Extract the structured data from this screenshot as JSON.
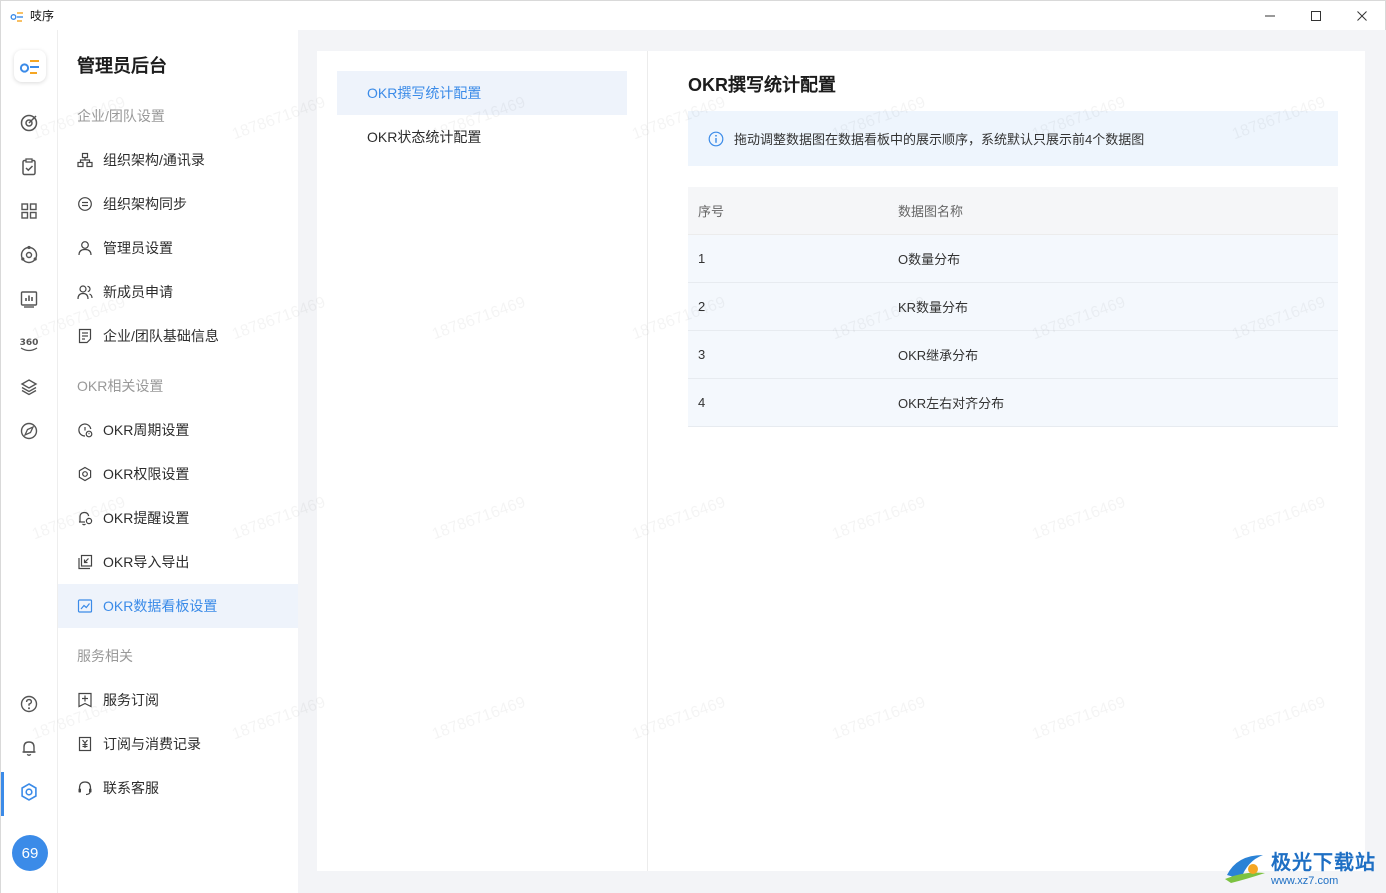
{
  "window": {
    "title": "吱序",
    "minimize": "—",
    "maximize": "☐",
    "close": "✕"
  },
  "rail": {
    "logo_icon": "app-logo-icon",
    "icons": [
      "target-icon",
      "clipboard-check-icon",
      "apps-grid-icon",
      "orbit-icon",
      "chart-board-icon",
      "360-icon",
      "layers-icon",
      "compass-icon",
      "help-icon",
      "bell-icon",
      "settings-icon"
    ],
    "avatar_text": "69"
  },
  "nav": {
    "title": "管理员后台",
    "sections": [
      {
        "label": "企业/团队设置"
      },
      {
        "label": "OKR相关设置"
      },
      {
        "label": "服务相关"
      }
    ],
    "items": [
      {
        "label": "组织架构/通讯录",
        "icon": "org-chart-icon"
      },
      {
        "label": "组织架构同步",
        "icon": "sync-icon"
      },
      {
        "label": "管理员设置",
        "icon": "user-icon"
      },
      {
        "label": "新成员申请",
        "icon": "users-icon"
      },
      {
        "label": "企业/团队基础信息",
        "icon": "document-icon"
      },
      {
        "label": "OKR周期设置",
        "icon": "cycle-icon"
      },
      {
        "label": "OKR权限设置",
        "icon": "gear-icon"
      },
      {
        "label": "OKR提醒设置",
        "icon": "bell-settings-icon"
      },
      {
        "label": "OKR导入导出",
        "icon": "import-export-icon"
      },
      {
        "label": "OKR数据看板设置",
        "icon": "dashboard-icon",
        "active": true
      },
      {
        "label": "服务订阅",
        "icon": "subscribe-icon"
      },
      {
        "label": "订阅与消费记录",
        "icon": "yen-record-icon"
      },
      {
        "label": "联系客服",
        "icon": "headset-icon"
      }
    ]
  },
  "sub_menu": {
    "items": [
      {
        "label": "OKR撰写统计配置",
        "active": true
      },
      {
        "label": "OKR状态统计配置"
      }
    ]
  },
  "main": {
    "title": "OKR撰写统计配置",
    "notice": "拖动调整数据图在数据看板中的展示顺序，系统默认只展示前4个数据图",
    "table": {
      "headers": [
        "序号",
        "数据图名称"
      ],
      "rows": [
        [
          "1",
          "O数量分布"
        ],
        [
          "2",
          "KR数量分布"
        ],
        [
          "3",
          "OKR继承分布"
        ],
        [
          "4",
          "OKR左右对齐分布"
        ]
      ]
    }
  },
  "watermark": "18786716469",
  "brand": {
    "name": "极光下载站",
    "url": "www.xz7.com"
  },
  "colors": {
    "accent": "#3b8be8",
    "active_bg": "#eef3fb",
    "notice_bg": "#eef5fd",
    "page_bg": "#f3f4f7"
  }
}
